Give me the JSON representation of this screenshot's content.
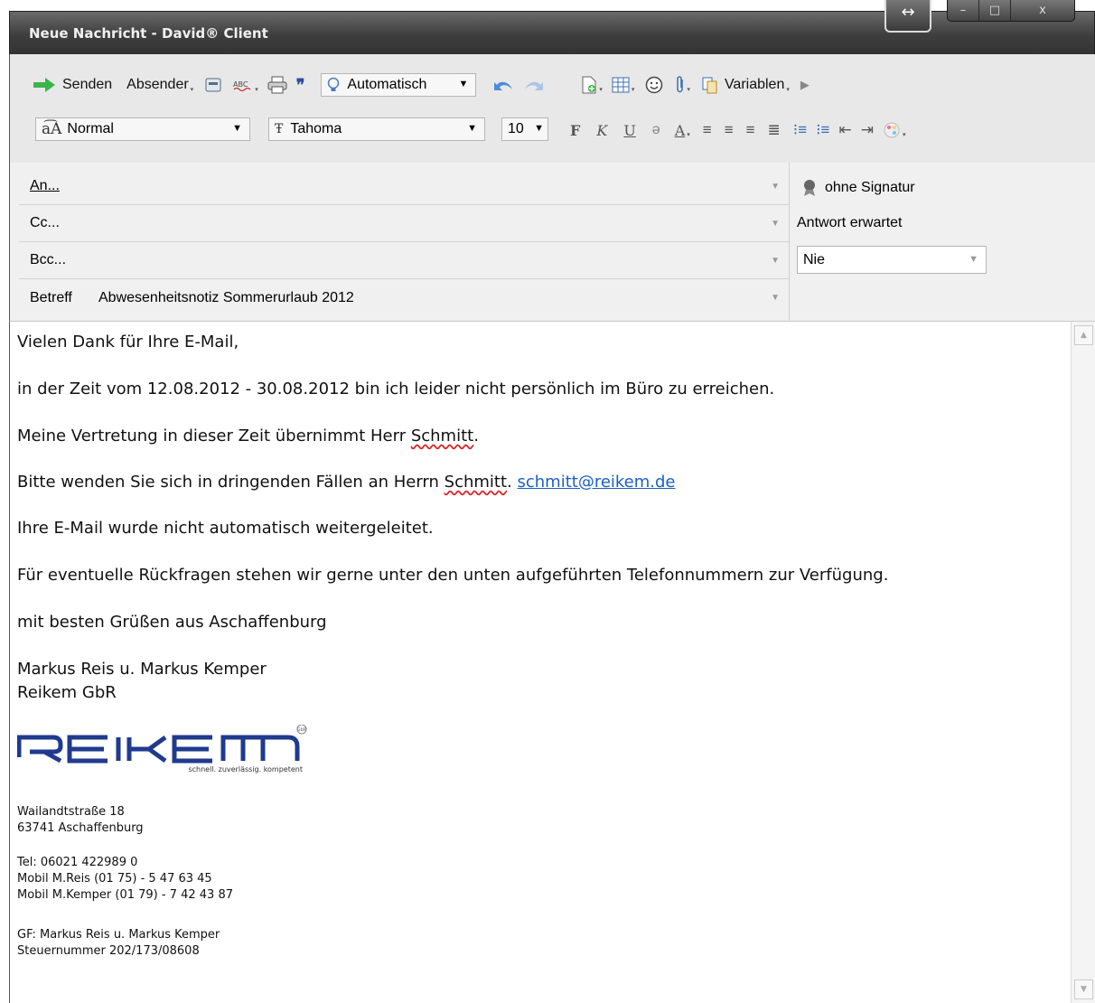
{
  "window": {
    "title": "Neue Nachricht - David® Client",
    "controls": {
      "resize": "↔",
      "minimize": "–",
      "maximize": "□",
      "close": "x"
    }
  },
  "toolbar": {
    "send": "Senden",
    "sender": "Absender",
    "priority_select": "Automatisch",
    "variables": "Variablen",
    "style_select": "Normal",
    "font_select": "Tahoma",
    "size_select": "10",
    "bold": "F",
    "italic": "K",
    "underline": "U",
    "strike": "ə",
    "fontcolor": "A",
    "icons": [
      "send-arrow-icon",
      "cut-icon",
      "spellcheck-icon",
      "print-icon",
      "quote-icon",
      "lightbulb-icon",
      "undo-icon",
      "redo-icon",
      "attach-file-icon",
      "table-icon",
      "smiley-icon",
      "paperclip-icon",
      "variables-icon",
      "play-icon",
      "style-icon",
      "font-icon"
    ]
  },
  "header": {
    "to_label": "An...",
    "cc_label": "Cc...",
    "bcc_label": "Bcc...",
    "subject_label": "Betreff",
    "subject_value": "Abwesenheitsnotiz Sommerurlaub 2012",
    "signature": "ohne Signatur",
    "reply_expected_label": "Antwort erwartet",
    "reply_expected_value": "Nie"
  },
  "body": {
    "greeting": "Vielen Dank für Ihre E-Mail,",
    "line1": "in der Zeit vom 12.08.2012 - 30.08.2012 bin ich leider nicht persönlich im Büro zu erreichen.",
    "line2_a": "Meine Vertretung in dieser Zeit übernimmt Herr ",
    "line2_name": "Schmitt",
    "line2_end": ".",
    "line3_a": "Bitte wenden Sie sich in dringenden Fällen an Herrn ",
    "line3_name": "Schmitt",
    "line3_dot": ". ",
    "email": "schmitt@reikem.de",
    "line4": "Ihre E-Mail wurde nicht automatisch weitergeleitet.",
    "line5": "Für eventuelle Rückfragen stehen wir gerne unter den unten aufgeführten Telefonnummern zur Verfügung.",
    "closing": "mit besten Grüßen aus Aschaffenburg",
    "names": "Markus Reis u. Markus Kemper",
    "company": "Reikem GbR",
    "logo_text": "REIKEM",
    "logo_tagline": "schnell. zuverlässig. kompetent",
    "logo_badge": "GbR",
    "address1": "Wailandtstraße 18",
    "address2": "63741 Aschaffenburg",
    "tel": "Tel: 06021 422989 0",
    "mobile1": "Mobil M.Reis (01 75) -  5 47 63 45",
    "mobile2": "Mobil M.Kemper (01 79) -  7 42 43 87",
    "gf": "GF: Markus Reis u. Markus Kemper",
    "tax": "Steuernummer 202/173/08608"
  },
  "colors": {
    "titlebar": "#3e3e3e",
    "toolbar": "#e8e8e8",
    "link": "#1a5fc7",
    "logo": "#1f3a8f",
    "send_arrow": "#3bb54a"
  }
}
